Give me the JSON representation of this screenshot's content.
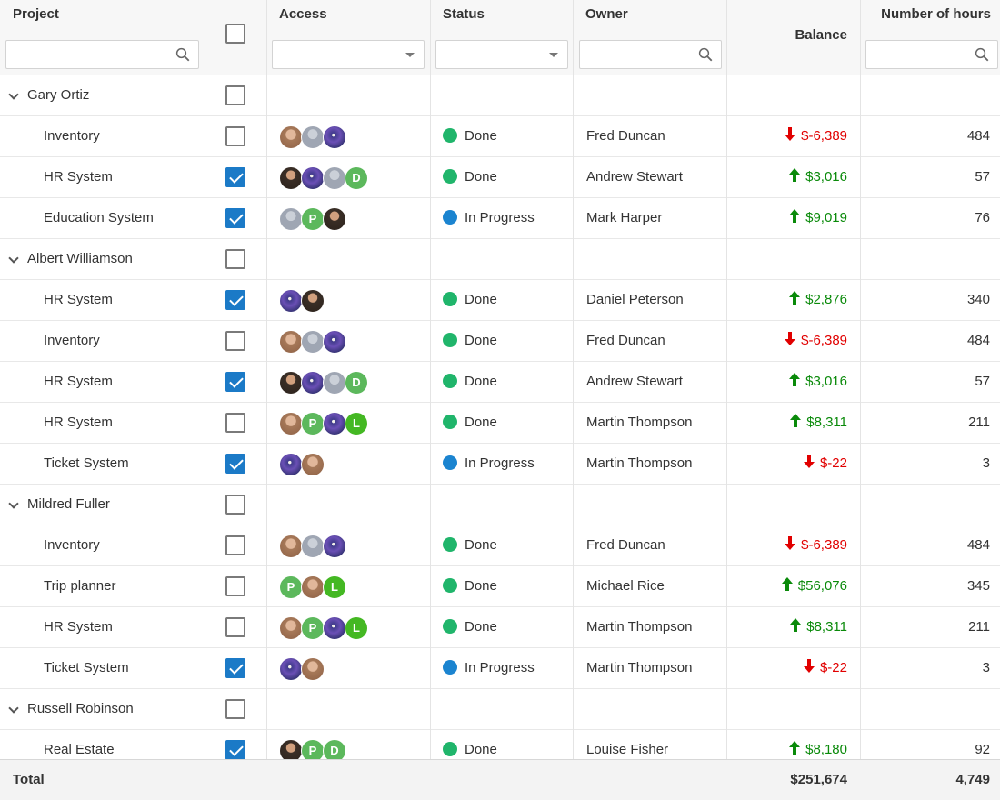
{
  "header": {
    "project": "Project",
    "access": "Access",
    "status": "Status",
    "owner": "Owner",
    "balance": "Balance",
    "hours": "Number of hours"
  },
  "footer": {
    "label": "Total",
    "balance_total": "$251,674",
    "hours_total": "4,749"
  },
  "colors": {
    "done": "#20b56b",
    "in_progress": "#1b84d0",
    "positive": "#0a8a0a",
    "negative": "#e10000",
    "checkbox": "#1b7ac7"
  },
  "rows": [
    {
      "type": "group",
      "label": "Gary Ortiz",
      "checked": false
    },
    {
      "type": "item",
      "project": "Inventory",
      "checked": false,
      "access": [
        "ph5",
        "ph2",
        "ph3"
      ],
      "status": "Done",
      "owner": "Fred Duncan",
      "balance": "$-6,389",
      "dir": "down",
      "hours": "484"
    },
    {
      "type": "item",
      "project": "HR System",
      "checked": true,
      "access": [
        "ph4",
        "ph3",
        "ph2",
        "D"
      ],
      "status": "Done",
      "owner": "Andrew Stewart",
      "balance": "$3,016",
      "dir": "up",
      "hours": "57"
    },
    {
      "type": "item",
      "project": "Education System",
      "checked": true,
      "access": [
        "ph2",
        "P",
        "ph4"
      ],
      "status": "In Progress",
      "owner": "Mark Harper",
      "balance": "$9,019",
      "dir": "up",
      "hours": "76"
    },
    {
      "type": "group",
      "label": "Albert Williamson",
      "checked": false
    },
    {
      "type": "item",
      "project": "HR System",
      "checked": true,
      "access": [
        "ph3",
        "ph4"
      ],
      "status": "Done",
      "owner": "Daniel Peterson",
      "balance": "$2,876",
      "dir": "up",
      "hours": "340"
    },
    {
      "type": "item",
      "project": "Inventory",
      "checked": false,
      "access": [
        "ph5",
        "ph2",
        "ph3"
      ],
      "status": "Done",
      "owner": "Fred Duncan",
      "balance": "$-6,389",
      "dir": "down",
      "hours": "484"
    },
    {
      "type": "item",
      "project": "HR System",
      "checked": true,
      "access": [
        "ph4",
        "ph3",
        "ph2",
        "D"
      ],
      "status": "Done",
      "owner": "Andrew Stewart",
      "balance": "$3,016",
      "dir": "up",
      "hours": "57"
    },
    {
      "type": "item",
      "project": "HR System",
      "checked": false,
      "access": [
        "ph5",
        "P",
        "ph3",
        "L"
      ],
      "status": "Done",
      "owner": "Martin Thompson",
      "balance": "$8,311",
      "dir": "up",
      "hours": "211"
    },
    {
      "type": "item",
      "project": "Ticket System",
      "checked": true,
      "access": [
        "ph3",
        "ph5"
      ],
      "status": "In Progress",
      "owner": "Martin Thompson",
      "balance": "$-22",
      "dir": "down",
      "hours": "3"
    },
    {
      "type": "group",
      "label": "Mildred Fuller",
      "checked": false
    },
    {
      "type": "item",
      "project": "Inventory",
      "checked": false,
      "access": [
        "ph5",
        "ph2",
        "ph3"
      ],
      "status": "Done",
      "owner": "Fred Duncan",
      "balance": "$-6,389",
      "dir": "down",
      "hours": "484"
    },
    {
      "type": "item",
      "project": "Trip planner",
      "checked": false,
      "access": [
        "P",
        "ph5",
        "L"
      ],
      "status": "Done",
      "owner": "Michael Rice",
      "balance": "$56,076",
      "dir": "up",
      "hours": "345"
    },
    {
      "type": "item",
      "project": "HR System",
      "checked": false,
      "access": [
        "ph5",
        "P",
        "ph3",
        "L"
      ],
      "status": "Done",
      "owner": "Martin Thompson",
      "balance": "$8,311",
      "dir": "up",
      "hours": "211"
    },
    {
      "type": "item",
      "project": "Ticket System",
      "checked": true,
      "access": [
        "ph3",
        "ph5"
      ],
      "status": "In Progress",
      "owner": "Martin Thompson",
      "balance": "$-22",
      "dir": "down",
      "hours": "3"
    },
    {
      "type": "group",
      "label": "Russell Robinson",
      "checked": false
    },
    {
      "type": "item",
      "project": "Real Estate",
      "checked": true,
      "access": [
        "ph4",
        "P",
        "D"
      ],
      "status": "Done",
      "owner": "Louise Fisher",
      "balance": "$8,180",
      "dir": "up",
      "hours": "92"
    }
  ]
}
